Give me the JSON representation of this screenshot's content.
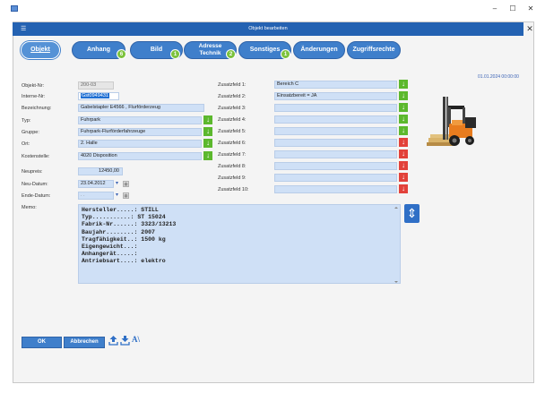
{
  "window": {
    "minimize": "–",
    "maximize": "☐",
    "close": "✕"
  },
  "dialog": {
    "title": "Objekt bearbeiten",
    "menu": "☰",
    "close": "✕"
  },
  "tabs": [
    {
      "label": "Objekt",
      "active": true,
      "badge": ""
    },
    {
      "label": "Anhang",
      "badge": "6"
    },
    {
      "label": "Bild",
      "badge": "1"
    },
    {
      "label1": "Adresse",
      "label2": "Technik",
      "badge": "2"
    },
    {
      "label": "Sonstiges",
      "badge": "1"
    },
    {
      "label": "Änderungen",
      "badge": ""
    },
    {
      "label": "Zugriffsrechte",
      "badge": ""
    }
  ],
  "datestamp": "01.01.2024 00:00:00",
  "form": {
    "objekt_nr": {
      "label": "Objekt-Nr:",
      "value": "200-03"
    },
    "interne_nr": {
      "label": "Interne-Nr:",
      "value": "Gst0949431"
    },
    "bezeichnung": {
      "label": "Bezeichnung:",
      "value": "Gabelstapler E4566 , Flurförderzeug"
    },
    "typ": {
      "label": "Typ:",
      "value": "Fuhrpark"
    },
    "gruppe": {
      "label": "Gruppe:",
      "value": "Fuhrpark-Flurförderfahrzeuge"
    },
    "ort": {
      "label": "Ort:",
      "value": "2. Halle"
    },
    "kostenstelle": {
      "label": "Kostenstelle:",
      "value": "4020 Disposition"
    },
    "neupreis": {
      "label": "Neupreis:",
      "value": "12450,00"
    },
    "neu_datum": {
      "label": "Neu-Datum:",
      "value": "23.04.2012"
    },
    "ende_datum": {
      "label": "Ende-Datum:",
      "value": ". ."
    },
    "memo_label": "Memo:"
  },
  "zusatzfelder": [
    {
      "label": "Zusatzfeld 1:",
      "value": "Bereich C",
      "arrow": "green"
    },
    {
      "label": "Zusatzfeld 2:",
      "value": "Einsatzbereit = JA",
      "arrow": "green"
    },
    {
      "label": "Zusatzfeld 3:",
      "value": "",
      "arrow": "green"
    },
    {
      "label": "Zusatzfeld 4:",
      "value": "",
      "arrow": "green"
    },
    {
      "label": "Zusatzfeld 5:",
      "value": "",
      "arrow": "green"
    },
    {
      "label": "Zusatzfeld 6:",
      "value": "",
      "arrow": "red"
    },
    {
      "label": "Zusatzfeld 7:",
      "value": "",
      "arrow": "red"
    },
    {
      "label": "Zusatzfeld 8:",
      "value": "",
      "arrow": "red"
    },
    {
      "label": "Zusatzfeld 9:",
      "value": "",
      "arrow": "red"
    },
    {
      "label": "Zusatzfeld 10:",
      "value": "",
      "arrow": "red"
    }
  ],
  "memo": "Hersteller.....: STILL\nTyp...........: ST 15024\nFabrik-Nr......: 3323/13213\nBaujahr........: 2007\nTragfähigkeit..: 1500 kg\nEigengewicht...:\nAnhangerät.....:\nAntriebsart....: elektro",
  "icons": {
    "dropdown_arrow": "↓",
    "expand_arrow": "⇕",
    "datepicker": "▾",
    "calendar": "▦"
  },
  "footer": {
    "ok": "OK",
    "cancel": "Abbrechen",
    "text_tool": "A\\"
  },
  "colors": {
    "accent": "#2462b2",
    "field": "#cfe0f6",
    "ok_green": "#5cb82d",
    "alert_red": "#e2413a"
  }
}
